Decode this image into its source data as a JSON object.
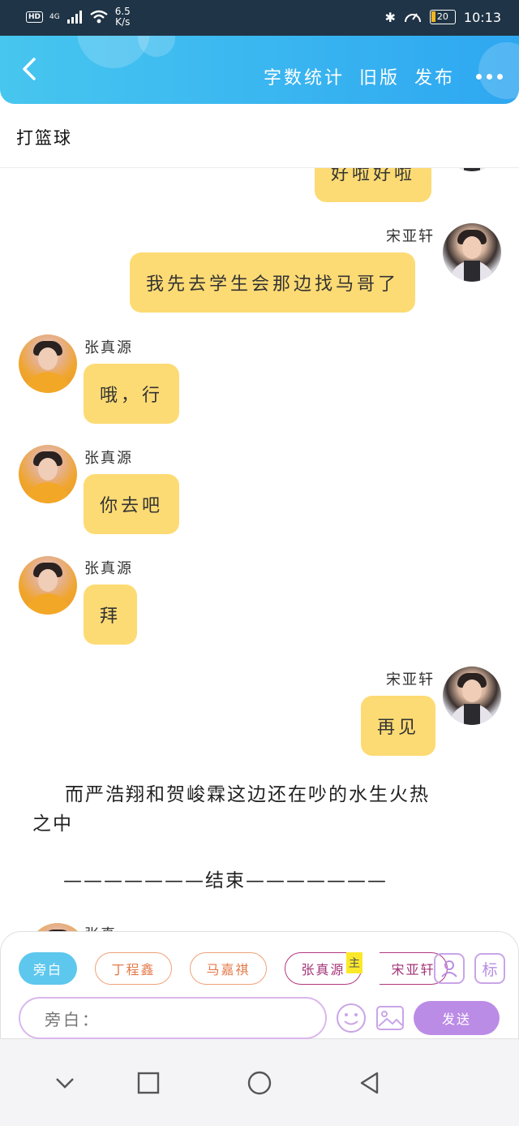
{
  "status_bar": {
    "hd": "HD",
    "network": "4G",
    "speed_value": "6.5",
    "speed_unit": "K/s",
    "battery": "20",
    "time": "10:13"
  },
  "header": {
    "actions": [
      "字数统计",
      "旧版",
      "发布"
    ]
  },
  "title": "打篮球",
  "messages": [
    {
      "side": "right",
      "speaker": "",
      "text": "好啦好啦"
    },
    {
      "side": "right",
      "speaker": "宋亚轩",
      "text": "我先去学生会那边找马哥了"
    },
    {
      "side": "left",
      "speaker": "张真源",
      "text": "哦，行"
    },
    {
      "side": "left",
      "speaker": "张真源",
      "text": "你去吧"
    },
    {
      "side": "left",
      "speaker": "张真源",
      "text": "拜"
    },
    {
      "side": "right",
      "speaker": "宋亚轩",
      "text": "再见"
    }
  ],
  "narration": {
    "line1": "而严浩翔和贺峻霖这边还在吵的水生火热",
    "line2": "之中",
    "end": "———————结束———————"
  },
  "partial_name": "张真",
  "panel": {
    "chips": [
      "旁白",
      "丁程鑫",
      "马嘉祺",
      "张真源",
      "宋亚轩"
    ],
    "main_tag": "主",
    "tag_button": "标",
    "input_placeholder": "旁白：",
    "send": "发送"
  },
  "colors": {
    "header_start": "#47c6ef",
    "header_end": "#2ea7f1",
    "bubble": "#fddb74",
    "send": "#bb8ce6"
  }
}
